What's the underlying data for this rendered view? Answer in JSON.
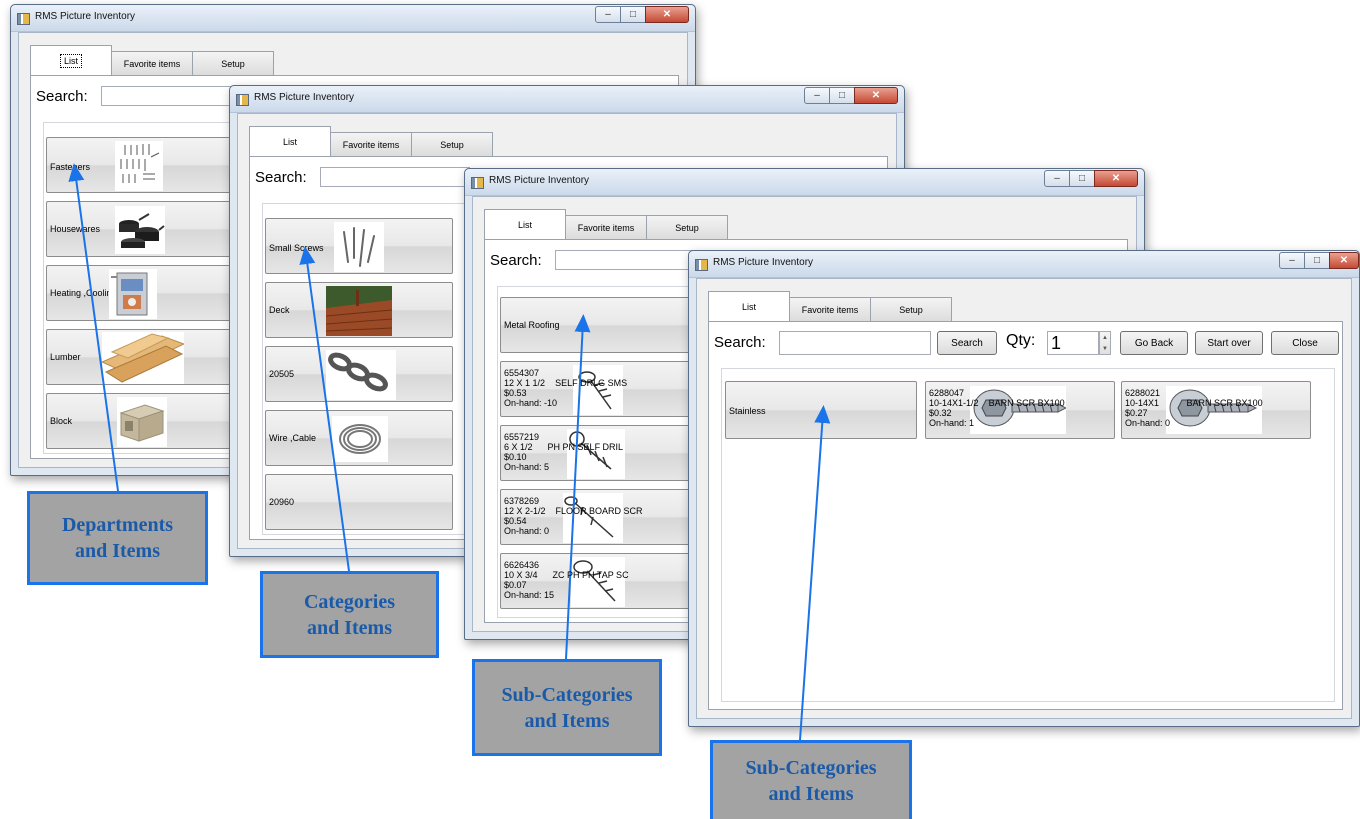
{
  "app_title": "RMS Picture Inventory",
  "tabs": [
    "List",
    "Favorite items",
    "Setup"
  ],
  "search_label": "Search:",
  "controls": {
    "search_button": "Search",
    "qty_label": "Qty:",
    "qty_value": "1",
    "go_back": "Go Back",
    "start_over": "Start over",
    "close": "Close"
  },
  "window1": {
    "items": [
      "Fasteners",
      "Housewares",
      "Heating ,Cooling",
      "Lumber",
      "Block"
    ]
  },
  "window2": {
    "items": [
      "Small Screws",
      "Deck",
      "20505",
      "Wire ,Cable",
      "20960"
    ]
  },
  "window3": {
    "category": "Metal Roofing",
    "products": [
      {
        "code": "6554307",
        "size": "12 X 1 1/2",
        "desc": "SELF DRLG SMS",
        "price": "$0.53",
        "onhand": "On-hand: -10"
      },
      {
        "code": "6557219",
        "size": "6 X 1/2",
        "desc": "PH PN SELF DRIL",
        "price": "$0.10",
        "onhand": "On-hand: 5"
      },
      {
        "code": "6378269",
        "size": "12 X 2-1/2",
        "desc": "FLOOR BOARD SCR",
        "price": "$0.54",
        "onhand": "On-hand: 0"
      },
      {
        "code": "6626436",
        "size": "10 X 3/4",
        "desc": "ZC PH PH TAP SC",
        "price": "$0.07",
        "onhand": "On-hand: 15"
      }
    ]
  },
  "window4": {
    "category": "Stainless",
    "products": [
      {
        "code": "6288047",
        "size": "10-14X1-1/2",
        "desc": "BARN SCR BX100",
        "price": "$0.32",
        "onhand": "On-hand: 1"
      },
      {
        "code": "6288021",
        "size": "10-14X1",
        "desc": "BARN SCR BX100",
        "price": "$0.27",
        "onhand": "On-hand: 0"
      }
    ]
  },
  "callouts": {
    "c1": [
      "Departments",
      "and Items"
    ],
    "c2": [
      "Categories",
      "and Items"
    ],
    "c3": [
      "Sub-Categories",
      "and Items"
    ],
    "c4": [
      "Sub-Categories",
      "and Items"
    ]
  },
  "colors": {
    "callout_border": "#1a73e8",
    "callout_text": "#1a5aa8",
    "callout_fill": "#a3a3a3",
    "close_button": "#c54a34"
  }
}
